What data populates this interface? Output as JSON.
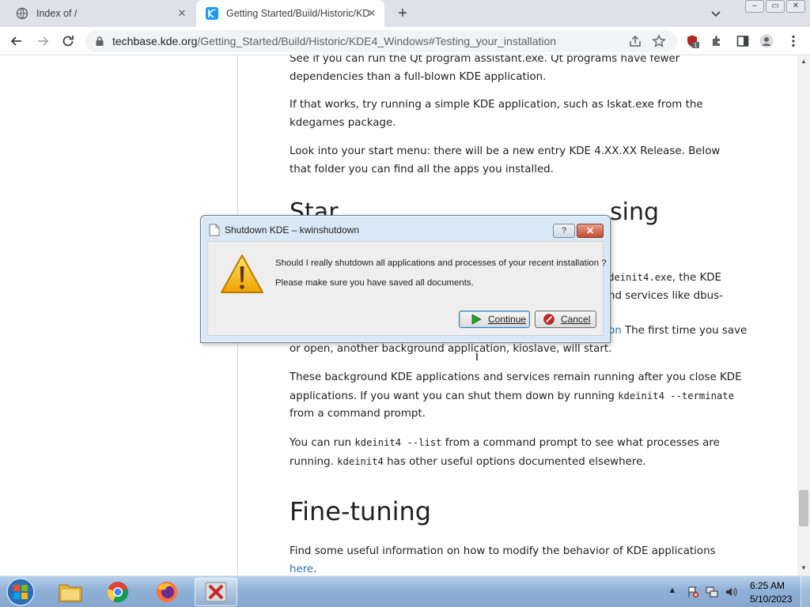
{
  "browser": {
    "tabs": [
      {
        "title": "Index of /",
        "active": false
      },
      {
        "title": "Getting Started/Build/Historic/KD",
        "active": true
      }
    ],
    "url_host": "techbase.kde.org",
    "url_path": "/Getting_Started/Build/Historic/KDE4_Windows#Testing_your_installation",
    "extension_badge": "1",
    "window_controls": {
      "minimize": "–",
      "maximize": "▭",
      "close": "✕"
    }
  },
  "page": {
    "para1": "See if you can run the Qt program assistant.exe. Qt programs have fewer dependencies than a full-blown KDE application.",
    "para2": "If that works, try running a simple KDE application, such as lskat.exe from the kdegames package.",
    "para3": "Look into your start menu: there will be a new entry KDE 4.XX.XX Release. Below that folder you can find all the apps you installed.",
    "heading_partial_left": "Star",
    "heading_partial_right": "sing",
    "para4_line1_code": "deinit4.exe",
    "para4_line1_text": ", the KDE",
    "para4_line2_text": "nd services like dbus-",
    "para5_line1_link": "on",
    "para5_line1_text": " The first time you save",
    "para5_line2": "or open, another background application, kioslave, will start.",
    "para6_before": "These background KDE applications and services remain running after you close KDE applications. If you want you can shut them down by running ",
    "para6_code": "kdeinit4 --terminate",
    "para6_after": " from a command prompt.",
    "para7_before": "You can run ",
    "para7_code1": "kdeinit4 --list",
    "para7_mid": " from a command prompt to see what processes are running. ",
    "para7_code2": "kdeinit4",
    "para7_after": " has other useful options documented elsewhere.",
    "heading_finetuning": "Fine-tuning",
    "para8_text": "Find some useful information on how to modify the behavior of KDE applications ",
    "para8_link": "here",
    "para8_end": "."
  },
  "dialog": {
    "title": "Shutdown KDE – kwinshutdown",
    "help_label": "?",
    "close_label": "✕",
    "message1": "Should I really shutdown all applications and processes of your recent installation ?",
    "message2": "Please make sure you have saved all documents.",
    "continue_label": "Continue",
    "cancel_label": "Cancel"
  },
  "taskbar": {
    "apps": [
      "windows-explorer",
      "chrome",
      "firefox",
      "kwinshutdown"
    ],
    "clock_time": "6:25 AM",
    "clock_date": "5/10/2023"
  },
  "colors": {
    "link": "#2a6ebb",
    "taskbar": "#8fb1d6",
    "dialog_frame": "#d9e8f6"
  }
}
